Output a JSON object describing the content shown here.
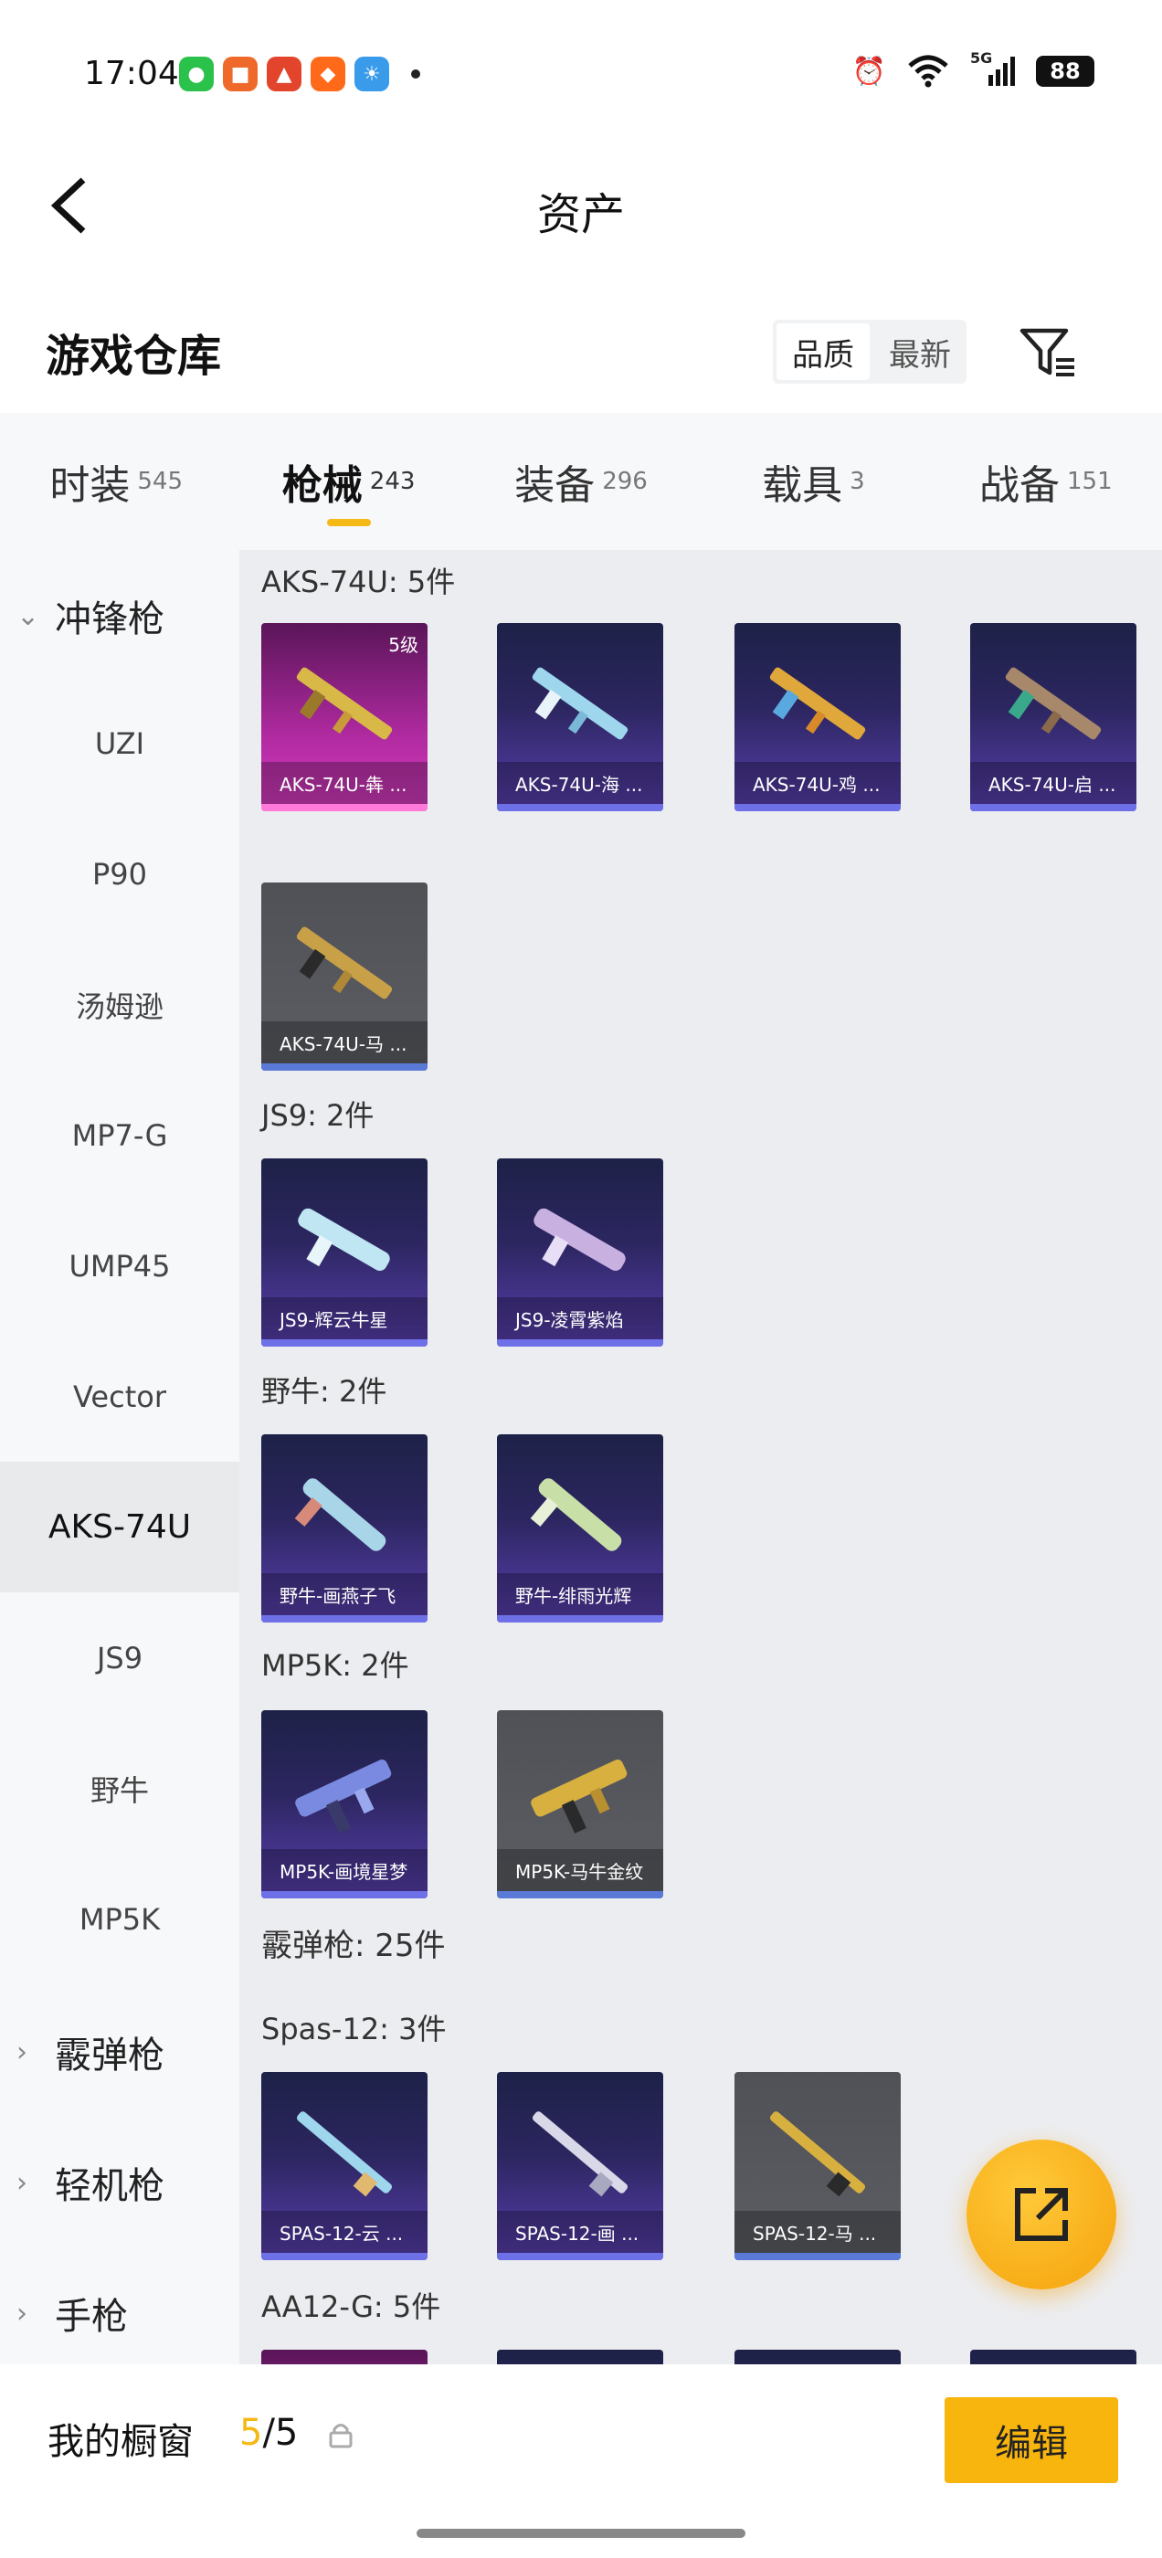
{
  "status_bar": {
    "time": "17:04",
    "battery": "88",
    "network": "5G"
  },
  "nav": {
    "title": "资产"
  },
  "warehouse": {
    "title": "游戏仓库",
    "sort_quality": "品质",
    "sort_newest": "最新"
  },
  "tabs": [
    {
      "label": "时装",
      "count": "545"
    },
    {
      "label": "枪械",
      "count": "243"
    },
    {
      "label": "装备",
      "count": "296"
    },
    {
      "label": "载具",
      "count": "3"
    },
    {
      "label": "战备",
      "count": "151"
    }
  ],
  "sidebar": {
    "group_smg": "冲锋枪",
    "items": [
      "UZI",
      "P90",
      "汤姆逊",
      "MP7-G",
      "UMP45",
      "Vector",
      "AKS-74U",
      "JS9",
      "野牛",
      "MP5K"
    ],
    "group_shotgun": "霰弹枪",
    "group_lmg": "轻机枪",
    "group_pistol": "手枪"
  },
  "content": {
    "sec_aks": "AKS-74U: 5件",
    "aks_cards": [
      {
        "label": "AKS-74U-犇 ...",
        "level": "5级"
      },
      {
        "label": "AKS-74U-海 ..."
      },
      {
        "label": "AKS-74U-鸡 ..."
      },
      {
        "label": "AKS-74U-启 ..."
      },
      {
        "label": "AKS-74U-马 ..."
      }
    ],
    "sec_js9": "JS9: 2件",
    "js9_cards": [
      {
        "label": "JS9-辉云牛星"
      },
      {
        "label": "JS9-凌霄紫焰"
      }
    ],
    "sec_bison": "野牛: 2件",
    "bison_cards": [
      {
        "label": "野牛-画燕子飞"
      },
      {
        "label": "野牛-绯雨光辉"
      }
    ],
    "sec_mp5k": "MP5K: 2件",
    "mp5k_cards": [
      {
        "label": "MP5K-画境星梦"
      },
      {
        "label": "MP5K-马牛金纹"
      }
    ],
    "sec_shotgun": "霰弹枪: 25件",
    "sec_spas": "Spas-12: 3件",
    "spas_cards": [
      {
        "label": "SPAS-12-云 ..."
      },
      {
        "label": "SPAS-12-画 ..."
      },
      {
        "label": "SPAS-12-马 ..."
      }
    ],
    "sec_aa12": "AA12-G: 5件"
  },
  "bottom": {
    "showcase_label": "我的橱窗",
    "count_current": "5",
    "count_total": "/5",
    "edit_label": "编辑"
  },
  "colors": {
    "accent": "#f5b916",
    "card_purple": "#2c2660",
    "card_pink": "#b02aa0",
    "card_gray": "#5c5e64"
  }
}
